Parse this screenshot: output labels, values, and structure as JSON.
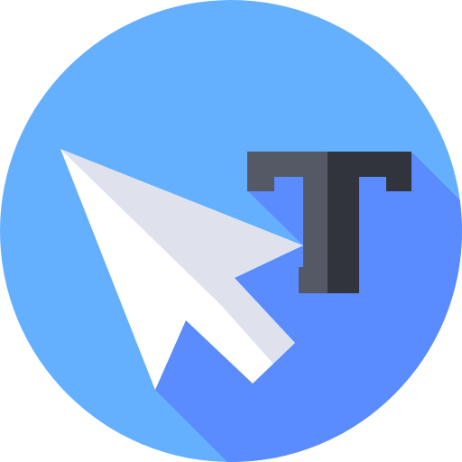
{
  "icon": {
    "name": "text-cursor-pointer-icon",
    "colors": {
      "circle": "#64b0ff",
      "long_shadow": "#5a8bff",
      "arrow_light": "#ffffff",
      "arrow_shade": "#dfe2ec",
      "text_tool_dark": "#31343d",
      "text_tool_light": "#555865"
    }
  }
}
